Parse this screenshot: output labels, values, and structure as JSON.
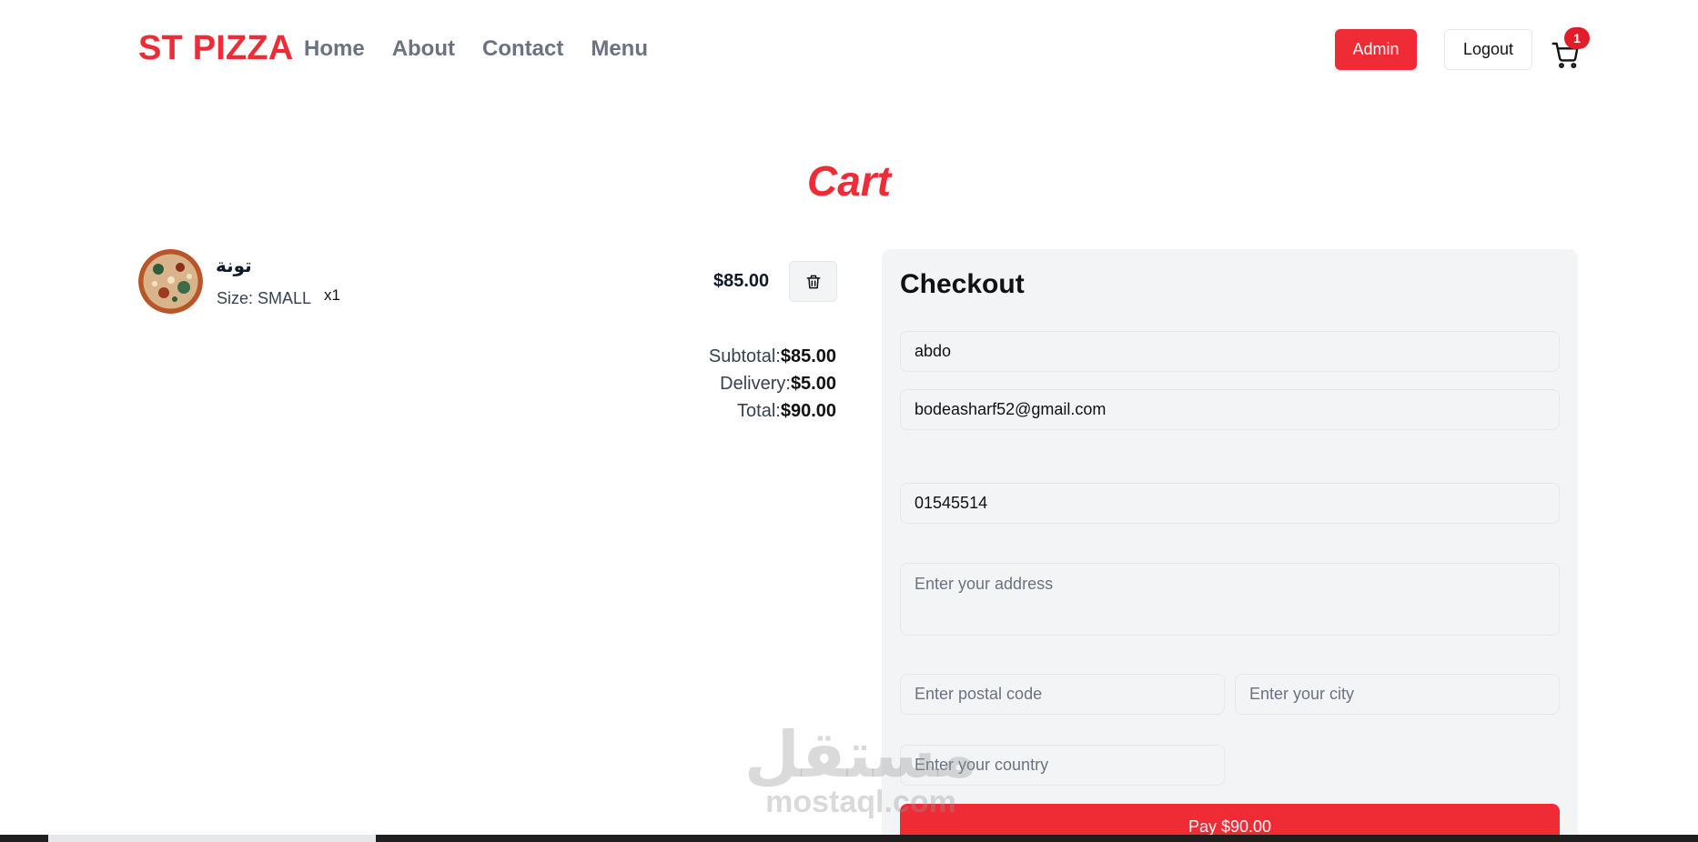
{
  "header": {
    "logo": "ST PIZZA",
    "nav": [
      "Home",
      "About",
      "Contact",
      "Menu"
    ],
    "admin_label": "Admin",
    "logout_label": "Logout",
    "cart_count": "1"
  },
  "page_title": "Cart",
  "cart": {
    "item": {
      "name": "تونة",
      "size": "Size: SMALL",
      "qty": "x1",
      "price": "$85.00"
    },
    "totals": {
      "subtotal_label": "Subtotal:",
      "subtotal_value": "$85.00",
      "delivery_label": "Delivery:",
      "delivery_value": "$5.00",
      "total_label": "Total:",
      "total_value": "$90.00"
    }
  },
  "checkout": {
    "title": "Checkout",
    "name_value": "abdo",
    "email_value": "bodeasharf52@gmail.com",
    "phone_value": "01545514",
    "address_placeholder": "Enter your address",
    "postal_placeholder": "Enter postal code",
    "city_placeholder": "Enter your city",
    "country_placeholder": "Enter your country",
    "pay_label": "Pay $90.00"
  },
  "watermark": {
    "arabic": "مستقل",
    "latin": "mostaql.com"
  },
  "colors": {
    "brand": "#ef2b36",
    "nav_text": "#6b7280",
    "panel_bg": "#f3f4f6"
  }
}
